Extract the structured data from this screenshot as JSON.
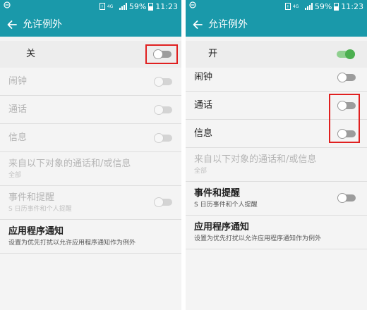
{
  "status_bar": {
    "battery": "59%",
    "time": "11:23",
    "network": "4G"
  },
  "header": {
    "title": "允许例外"
  },
  "left_screen": {
    "master": {
      "label": "关",
      "state": "off"
    },
    "items": [
      {
        "label": "闹钟",
        "state": "off",
        "enabled": false
      },
      {
        "label": "通话",
        "state": "off",
        "enabled": false
      },
      {
        "label": "信息",
        "state": "off",
        "enabled": false
      },
      {
        "label": "来自以下对象的通话和/或信息",
        "sub": "全部",
        "enabled": false
      },
      {
        "label": "事件和提醒",
        "sub": "S 日历事件和个人提醒",
        "state": "off",
        "enabled": false
      },
      {
        "label": "应用程序通知",
        "sub": "设置为优先打扰以允许应用程序通知作为例外",
        "enabled": true
      }
    ]
  },
  "right_screen": {
    "master": {
      "label": "开",
      "state": "on"
    },
    "items": [
      {
        "label": "闹钟",
        "state": "off",
        "enabled": true
      },
      {
        "label": "通话",
        "state": "off",
        "enabled": true
      },
      {
        "label": "信息",
        "state": "off",
        "enabled": true
      },
      {
        "label": "来自以下对象的通话和/或信息",
        "sub": "全部",
        "enabled": false
      },
      {
        "label": "事件和提醒",
        "sub": "S 日历事件和个人提醒",
        "state": "off",
        "enabled": true
      },
      {
        "label": "应用程序通知",
        "sub": "设置为优先打扰以允许应用程序通知作为例外",
        "enabled": true
      }
    ]
  },
  "colors": {
    "accent": "#1a99aa",
    "toggle_on": "#4caf50",
    "toggle_off": "#9c9c9c",
    "highlight": "#e02020"
  }
}
